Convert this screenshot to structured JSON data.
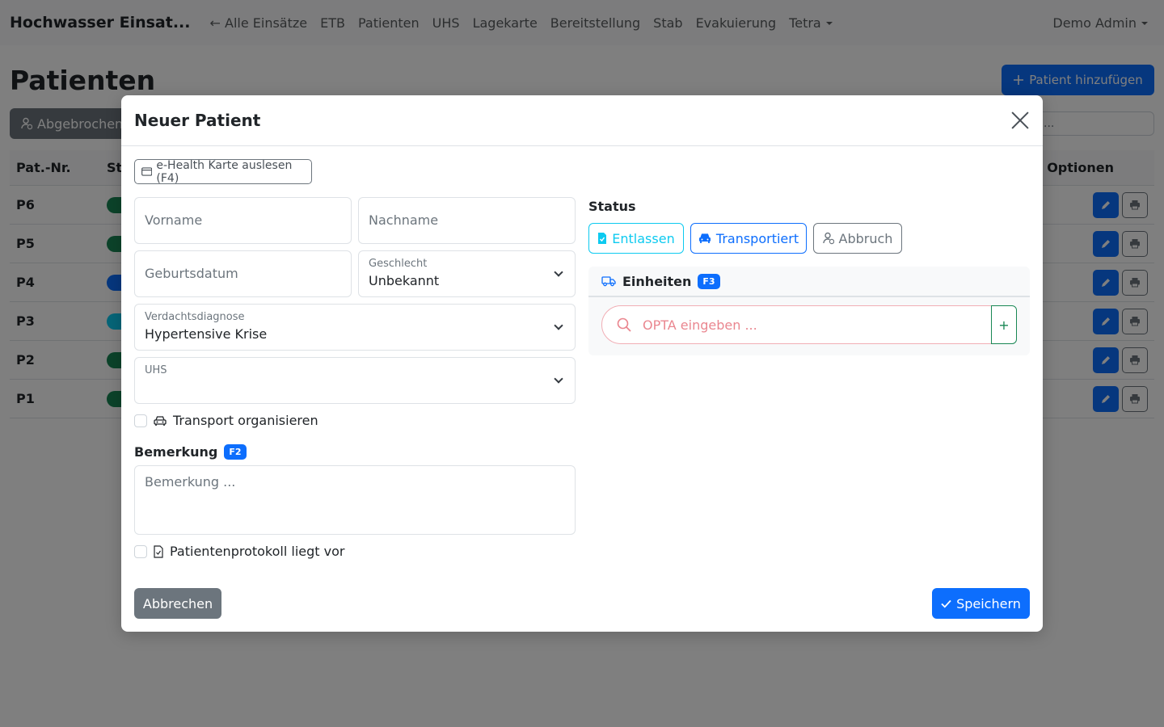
{
  "navbar": {
    "brand": "Hochwasser Einsat...",
    "items": [
      "← Alle Einsätze",
      "ETB",
      "Patienten",
      "UHS",
      "Lagekarte",
      "Bereitstellung",
      "Stab",
      "Evakuierung"
    ],
    "dropdown_item": "Tetra",
    "user": "Demo Admin"
  },
  "page": {
    "title": "Patienten",
    "add_button": "Patient hinzufügen",
    "filter_button": "Abgebrochen",
    "search_placeholder": "..."
  },
  "table": {
    "columns": [
      "Pat.-Nr.",
      "St",
      "Optionen"
    ],
    "rows": [
      {
        "nr": "P6",
        "status_color": "#198754"
      },
      {
        "nr": "P5",
        "status_color": "#198754"
      },
      {
        "nr": "P4",
        "status_color": "#0d6efd"
      },
      {
        "nr": "P3",
        "status_color": "#0dcaf0"
      },
      {
        "nr": "P2",
        "status_color": "#198754"
      },
      {
        "nr": "P1",
        "status_color": "#198754"
      }
    ]
  },
  "modal": {
    "title": "Neuer Patient",
    "ehealth_button": "e-Health Karte auslesen (F4)",
    "fields": {
      "first_name_placeholder": "Vorname",
      "last_name_placeholder": "Nachname",
      "birthdate_placeholder": "Geburtsdatum",
      "gender_label": "Geschlecht",
      "gender_value": "Unbekannt",
      "diagnosis_label": "Verdachtsdiagnose",
      "diagnosis_value": "Hypertensive Krise",
      "uhs_label": "UHS",
      "uhs_value": ""
    },
    "transport_checkbox": "Transport organisieren",
    "remark_label": "Bemerkung",
    "remark_badge": "F2",
    "remark_placeholder": "Bemerkung ...",
    "protocol_checkbox": "Patientenprotokoll liegt vor",
    "status": {
      "label": "Status",
      "buttons": [
        "Entlassen",
        "Transportiert",
        "Abbruch"
      ]
    },
    "units": {
      "title": "Einheiten",
      "badge": "F3",
      "input_placeholder": "OPTA eingeben ...",
      "add_label": "+"
    },
    "cancel_button": "Abbrechen",
    "save_button": "Speichern"
  },
  "colors": {
    "primary": "#0d6efd",
    "secondary": "#6c757d",
    "info": "#0dcaf0",
    "success": "#198754",
    "danger_light": "#ea868f"
  }
}
